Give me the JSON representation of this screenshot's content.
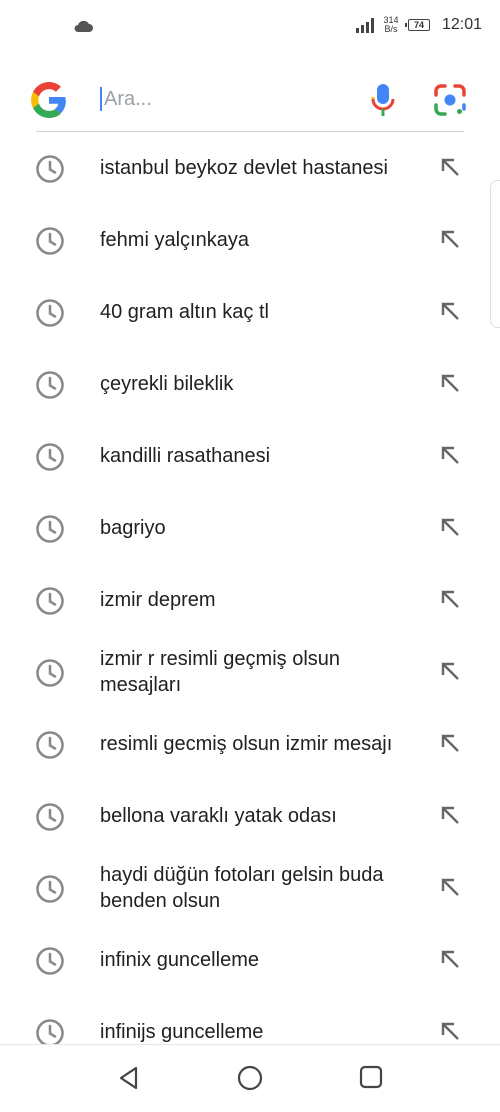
{
  "status_bar": {
    "left_icon": "cloud-icon",
    "net_speed_value": "314",
    "net_speed_unit": "B/s",
    "battery": "74",
    "time": "12:01"
  },
  "search": {
    "placeholder": "Ara...",
    "value": "",
    "icons": [
      "google-logo-icon",
      "microphone-icon",
      "google-lens-icon"
    ]
  },
  "history": [
    {
      "text": "istanbul beykoz devlet hastanesi"
    },
    {
      "text": "fehmi yalçınkaya"
    },
    {
      "text": "40 gram altın kaç tl"
    },
    {
      "text": "çeyrekli bileklik"
    },
    {
      "text": "kandilli rasathanesi"
    },
    {
      "text": "bagriyo"
    },
    {
      "text": "izmir deprem"
    },
    {
      "text": "izmir r resimli geçmiş olsun mesajları"
    },
    {
      "text": "resimli gecmiş olsun izmir mesajı"
    },
    {
      "text": "bellona varaklı yatak odası"
    },
    {
      "text": "haydi düğün fotoları gelsin buda benden olsun"
    },
    {
      "text": "infinix guncelleme"
    },
    {
      "text": "infinijs guncelleme"
    }
  ],
  "nav": [
    "back-icon",
    "home-icon",
    "recents-icon"
  ],
  "colors": {
    "google_blue": "#4285f4",
    "google_red": "#ea4335",
    "google_yellow": "#fbbc05",
    "google_green": "#34a853",
    "icon_gray": "#8a8a8a"
  }
}
